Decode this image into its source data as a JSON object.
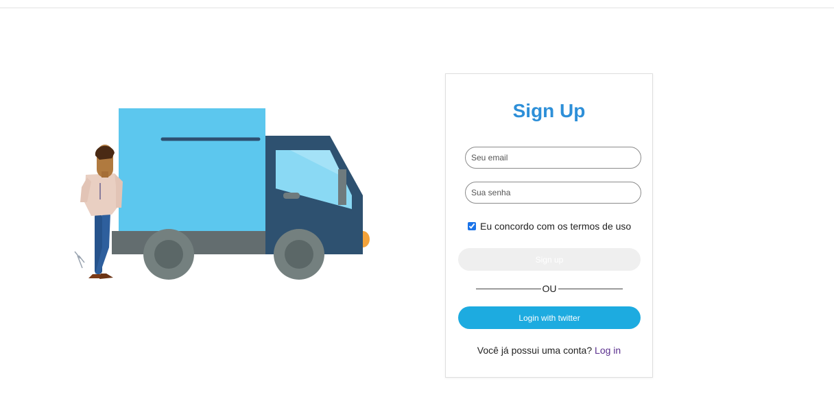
{
  "signup": {
    "title": "Sign Up",
    "email_placeholder": "Seu email",
    "password_placeholder": "Sua senha",
    "terms_label": "Eu concordo com os termos de uso",
    "terms_checked": true,
    "signup_button": "Sign up",
    "divider_text": "OU",
    "twitter_button": "Login with twitter",
    "have_account_text": "Você já possui uma conta?",
    "login_link": "Log in"
  },
  "colors": {
    "title": "#2d8fd8",
    "twitter": "#1dabe0",
    "signup_disabled": "#efefef",
    "link": "#5a2f8e"
  }
}
